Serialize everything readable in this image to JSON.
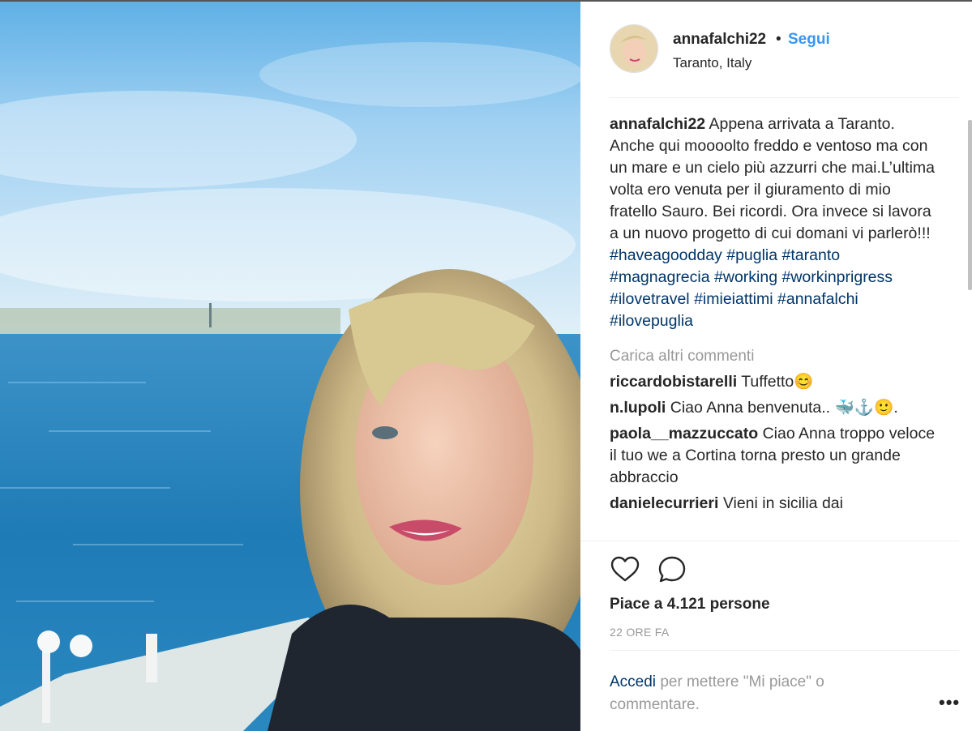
{
  "post": {
    "username": "annafalchi22",
    "separator": "•",
    "follow_label": "Segui",
    "location": "Taranto, Italy",
    "caption_user": "annafalchi22",
    "caption_text": "Appena arrivata a Taranto. Anche qui moooolto freddo e ventoso ma con un mare e un cielo più azzurri che mai.L’ultima volta ero venuta per il giuramento di mio fratello Sauro. Bei ricordi. Ora invece si lavora a un nuovo progetto di cui domani vi parlerò!!!",
    "hashtags": [
      "#haveagoodday",
      "#puglia",
      "#taranto",
      "#magnagrecia",
      "#working",
      "#workinprigress",
      "#ilovetravel",
      "#imieiattimi",
      "#annafalchi",
      "#ilovepuglia"
    ],
    "load_more_label": "Carica altri commenti",
    "comments": [
      {
        "user": "riccardobistarelli",
        "text": "Tuffetto😊"
      },
      {
        "user": "n.lupoli",
        "text": "Ciao Anna benvenuta.. 🐳⚓🙂."
      },
      {
        "user": "paola__mazzuccato",
        "text": "Ciao Anna troppo veloce il tuo we a Cortina torna presto un grande abbraccio"
      },
      {
        "user": "danielecurrieri",
        "text": "Vieni in sicilia dai"
      }
    ],
    "likes_text": "Piace a 4.121 persone",
    "time_ago": "22 ORE FA",
    "login_link": "Accedi",
    "login_text": "per mettere \"Mi piace\" o commentare.",
    "more_label": "•••"
  },
  "icons": {
    "like": "heart-icon",
    "comment": "comment-icon",
    "more": "more-options-icon"
  },
  "colors": {
    "link_blue": "#3897f0",
    "hashtag_navy": "#003569",
    "muted_gray": "#999999",
    "text": "#262626"
  }
}
